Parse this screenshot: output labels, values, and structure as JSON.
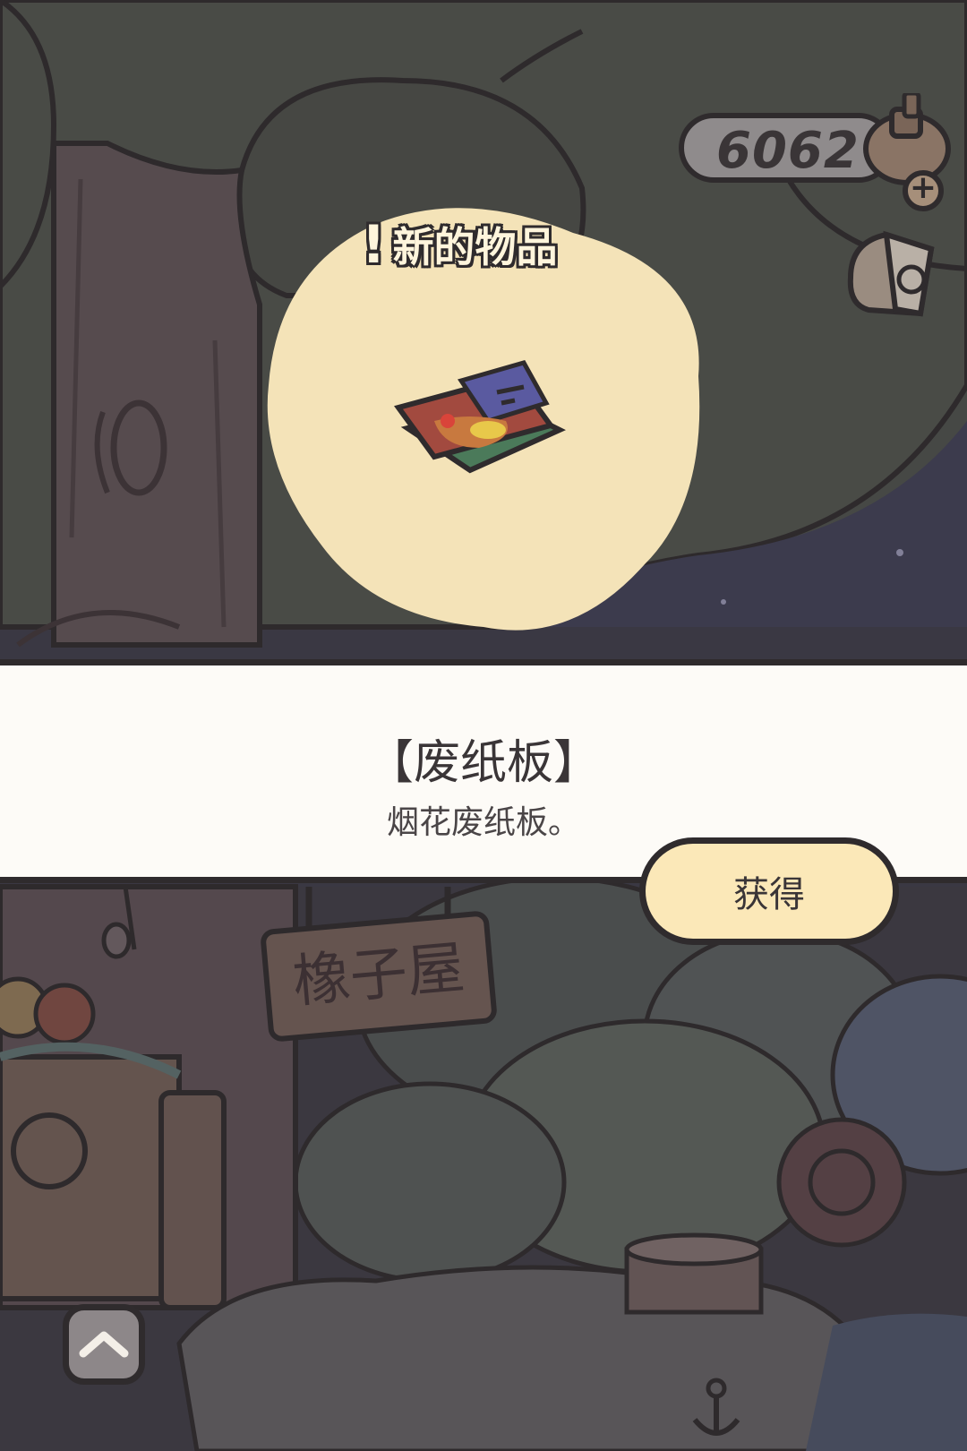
{
  "hud": {
    "clover_count": "6062",
    "plus_symbol": "+"
  },
  "notification": {
    "badge_icon": "!",
    "title": "新的物品"
  },
  "item": {
    "name": "【废纸板】",
    "description": "烟花废纸板。"
  },
  "actions": {
    "obtain_label": "获得"
  },
  "scene": {
    "shop_sign": "橡子屋"
  },
  "icons": [
    "clover-jar-icon",
    "postcard-icon",
    "chevron-up-icon",
    "firework-cardboard-icon",
    "anchor-icon"
  ],
  "colors": {
    "panel_bg": "#fdfbf7",
    "button_bg": "#fbe8b8",
    "outline": "#2f2b2d",
    "spotlight": "#f4e3b8"
  }
}
